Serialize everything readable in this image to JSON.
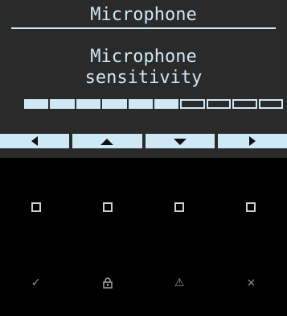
{
  "screen": {
    "title": "Microphone",
    "body_line1": "Microphone",
    "body_line2": "sensitivity",
    "level": {
      "value": 6,
      "max": 10
    },
    "colors": {
      "display_bg": "#2a2a2a",
      "display_fg": "#cfe8f5",
      "keypad_bg": "#000000"
    }
  },
  "softkeys": [
    {
      "icon": "arrow-left-icon"
    },
    {
      "icon": "arrow-up-icon"
    },
    {
      "icon": "arrow-down-icon"
    },
    {
      "icon": "arrow-right-icon"
    }
  ],
  "keypad": {
    "row1": [
      "square-icon",
      "square-icon",
      "square-icon",
      "square-icon"
    ],
    "row2": {
      "ok": "✓",
      "lock": "🔒",
      "warning": "⚠",
      "cancel": "×"
    }
  }
}
